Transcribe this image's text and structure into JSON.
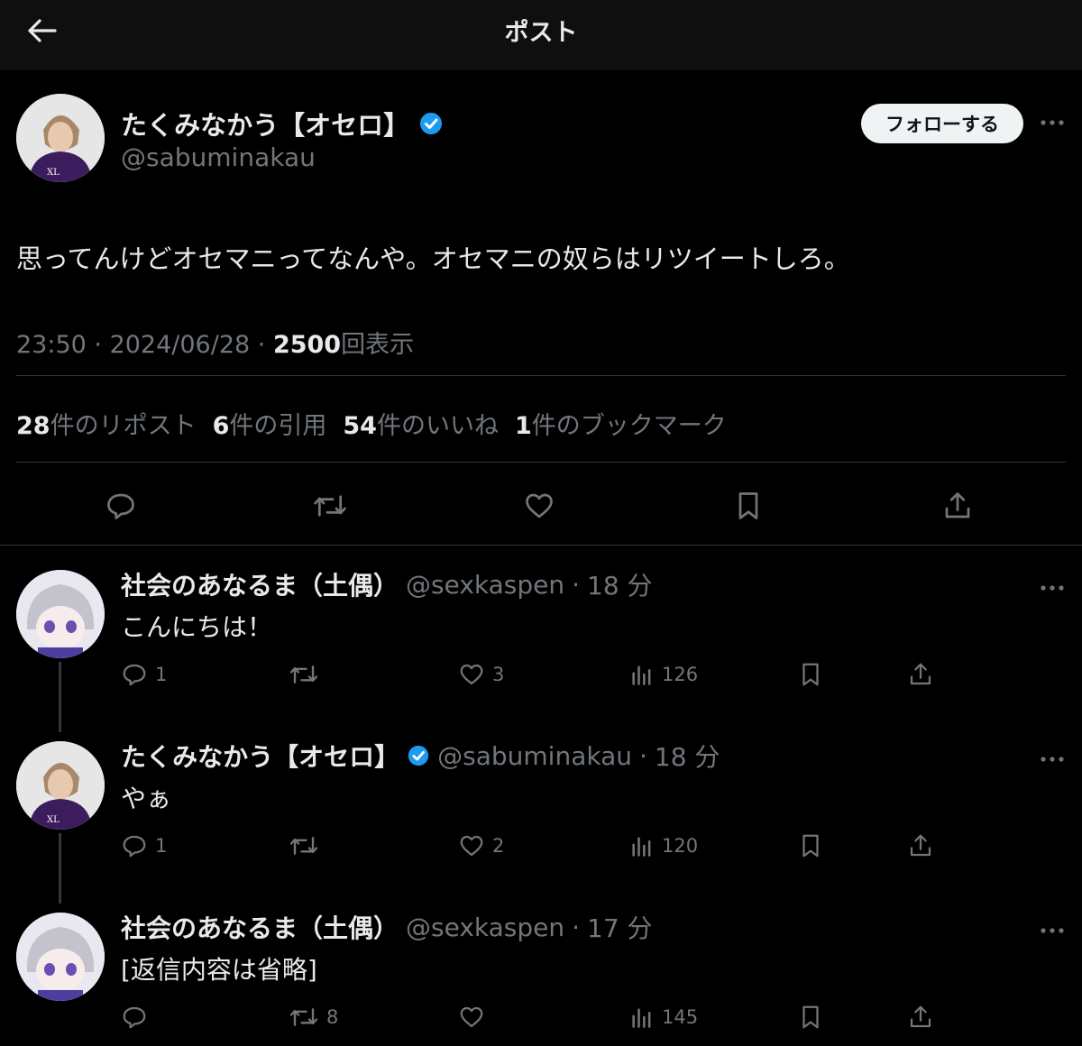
{
  "header": {
    "title": "ポスト"
  },
  "main_post": {
    "author_name": "たくみなかう【オセロ】",
    "author_handle": "@sabuminakau",
    "follow_label": "フォローする",
    "text": "思ってんけどオセマニってなんや。オセマニの奴らはリツイートしろ。",
    "time": "23:50",
    "date": "2024/06/28",
    "views": "2500",
    "views_label": "回表示",
    "stats": {
      "reposts": "28",
      "reposts_label": "件のリポスト",
      "quotes": "6",
      "quotes_label": "件の引用",
      "likes": "54",
      "likes_label": "件のいいね",
      "bookmarks": "1",
      "bookmarks_label": "件のブックマーク"
    }
  },
  "replies": [
    {
      "name": "社会のあなるま（土偶）",
      "handle": "@sexkaspen",
      "time": "18 分",
      "text": "こんにちは！",
      "replies": "1",
      "reposts": "",
      "likes": "3",
      "views": "126"
    },
    {
      "name": "たくみなかう【オセロ】",
      "handle": "@sabuminakau",
      "time": "18 分",
      "text": "やぁ",
      "replies": "1",
      "reposts": "",
      "likes": "2",
      "views": "120"
    },
    {
      "name": "社会のあなるま（土偶）",
      "handle": "@sexkaspen",
      "time": "17 分",
      "text": "[返信内容は省略]",
      "replies": "",
      "reposts": "8",
      "likes": "",
      "views": "145"
    }
  ],
  "colors": {
    "background": "#000000",
    "text": "#e7e9ea",
    "muted": "#71767b",
    "verified": "#1d9bf0",
    "divider": "#2f3336"
  }
}
